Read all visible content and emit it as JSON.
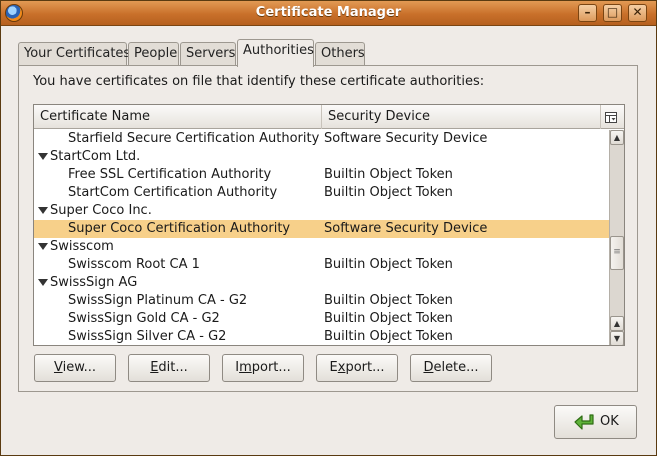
{
  "window": {
    "title": "Certificate Manager",
    "controls": {
      "minimize": "–",
      "maximize": "□",
      "close": "✕"
    }
  },
  "tabs": [
    {
      "label": "Your Certificates"
    },
    {
      "label": "People"
    },
    {
      "label": "Servers"
    },
    {
      "label": "Authorities",
      "active": true
    },
    {
      "label": "Others"
    }
  ],
  "panel": {
    "intro": "You have certificates on file that identify these certificate authorities:"
  },
  "tree": {
    "columns": {
      "name": "Certificate Name",
      "device": "Security Device"
    },
    "rows": [
      {
        "name": "Starfield Secure Certification Authority",
        "device": "Software Security Device",
        "level": 1
      },
      {
        "name": "StartCom Ltd.",
        "device": "",
        "level": 0,
        "expanded": true
      },
      {
        "name": "Free SSL Certification Authority",
        "device": "Builtin Object Token",
        "level": 1
      },
      {
        "name": "StartCom Certification Authority",
        "device": "Builtin Object Token",
        "level": 1
      },
      {
        "name": "Super Coco Inc.",
        "device": "",
        "level": 0,
        "expanded": true
      },
      {
        "name": "Super Coco Certification Authority",
        "device": "Software Security Device",
        "level": 1,
        "selected": true
      },
      {
        "name": "Swisscom",
        "device": "",
        "level": 0,
        "expanded": true
      },
      {
        "name": "Swisscom Root CA 1",
        "device": "Builtin Object Token",
        "level": 1
      },
      {
        "name": "SwissSign AG",
        "device": "",
        "level": 0,
        "expanded": true
      },
      {
        "name": "SwissSign Platinum CA - G2",
        "device": "Builtin Object Token",
        "level": 1
      },
      {
        "name": "SwissSign Gold CA - G2",
        "device": "Builtin Object Token",
        "level": 1
      },
      {
        "name": "SwissSign Silver CA - G2",
        "device": "Builtin Object Token",
        "level": 1
      }
    ]
  },
  "buttons": {
    "view": {
      "mnemonic": "V",
      "rest": "iew..."
    },
    "edit": {
      "mnemonic": "E",
      "rest": "dit..."
    },
    "import": {
      "pre": "I",
      "mnemonic": "m",
      "rest": "port..."
    },
    "export": {
      "pre": "E",
      "mnemonic": "x",
      "rest": "port..."
    },
    "delete": {
      "mnemonic": "D",
      "rest": "elete..."
    },
    "ok": "OK"
  },
  "colors": {
    "selection": "#f7d08a",
    "titlebar": "#c9702a"
  },
  "icons": {
    "app": "firefox-icon",
    "column_picker": "column-picker-icon",
    "ok": "green-arrow-icon"
  }
}
